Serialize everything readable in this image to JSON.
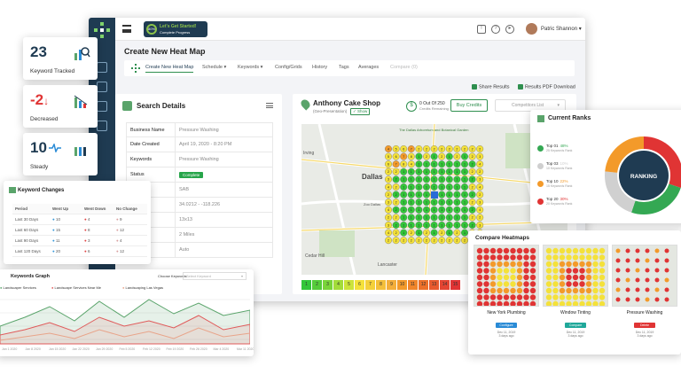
{
  "app": {
    "promo": {
      "progress": "80%",
      "title": "Let's Get Started!",
      "subtitle": "Complete Progress"
    },
    "user": {
      "name": "Patric Shannon"
    },
    "page_title": "Create New Heat Map",
    "tabs": [
      {
        "label": "Create New Heat Map",
        "active": true
      },
      {
        "label": "Schedule",
        "dropdown": true
      },
      {
        "label": "Keywords",
        "dropdown": true
      },
      {
        "label": "Config/Grids"
      },
      {
        "label": "History"
      },
      {
        "label": "Tags"
      },
      {
        "label": "Averages"
      },
      {
        "label": "Compare (0)",
        "disabled": true
      }
    ],
    "actions": {
      "share": "Share Results",
      "pdf": "Results PDF Download"
    }
  },
  "search_details": {
    "title": "Search Details",
    "rows": [
      {
        "key": "Business Name",
        "value": "Pressure Washing"
      },
      {
        "key": "Date Created",
        "value": "April 19, 2020 - 8:20 PM"
      },
      {
        "key": "Keywords",
        "value": "Pressure Washing"
      },
      {
        "key": "Status",
        "value": "Complete",
        "badge": true
      },
      {
        "key": "",
        "value": "SAB"
      },
      {
        "key": "",
        "value": "34.0212 - -118.226"
      },
      {
        "key": "",
        "value": "13x13"
      },
      {
        "key": "",
        "value": "2 Miles"
      },
      {
        "key": "",
        "value": "Auto"
      }
    ]
  },
  "map_card": {
    "business": "Anthony Cake Shop",
    "sub": "(Geo-Presentation)",
    "show_label": "Show",
    "credits_line1": "0 Out Of 250",
    "credits_line2": "Credits Remaining",
    "buy_label": "Buy Credits",
    "competitors_placeholder": "Competitors List",
    "city_labels": [
      "Dallas",
      "Irving",
      "Lancaster",
      "The Dallas Arboretum and Botanical Garden",
      "Zoo Dallas",
      "Cedar Hill"
    ],
    "scale": [
      "1",
      "2",
      "3",
      "4",
      "5",
      "6",
      "7",
      "8",
      "9",
      "10",
      "11",
      "12",
      "13",
      "14",
      "15"
    ],
    "colors": {
      "green": "#33c63a",
      "yellow": "#f4e13a",
      "orange": "#f39a2a",
      "red": "#e03434"
    }
  },
  "stats": [
    {
      "value": "23",
      "label": "Keyword Tracked",
      "icon": "magnifier-chart-icon"
    },
    {
      "value": "-2",
      "arrow": "↓",
      "label": "Decreased",
      "icon": "bar-chart-down-icon"
    },
    {
      "value": "10",
      "arrow": "⁄⁄",
      "label": "Steady",
      "icon": "steady-chart-icon"
    }
  ],
  "keyword_changes": {
    "title": "Keyword Changes",
    "headers": [
      "Period",
      "Went Up",
      "Went Down",
      "No Change"
    ],
    "rows": [
      {
        "period": "Last 30 Days",
        "up": "10",
        "down": "4",
        "none": "9"
      },
      {
        "period": "Last 60 Days",
        "up": "15",
        "down": "8",
        "none": "12"
      },
      {
        "period": "Last 90 Days",
        "up": "11",
        "down": "3",
        "none": "4"
      },
      {
        "period": "Last 120 Days",
        "up": "20",
        "down": "6",
        "none": "12"
      }
    ]
  },
  "keywords_graph": {
    "title": "Keywords Graph",
    "choose_label": "Choose Keywords",
    "choose_placeholder": "Select Keyword",
    "legend": [
      "Landscaper Services",
      "Landscape Services Near Me",
      "Landscaping Las Vegas"
    ],
    "x_labels": [
      "Jan 1 2020",
      "Jan 8 2020",
      "Jan 15 2020",
      "Jan 22 2020",
      "Jan 29 2020",
      "Feb 5 2020",
      "Feb 12 2020",
      "Feb 19 2020",
      "Feb 26 2020",
      "Mar 4 2020",
      "Mar 11 2020"
    ]
  },
  "current_ranks": {
    "title": "Current Ranks",
    "center_label": "RANKING",
    "items": [
      {
        "title": "Top 01",
        "pct": "48%",
        "sub": "25 Keywords Rank",
        "color": "#34a853"
      },
      {
        "title": "Top 03",
        "pct": "10%",
        "sub": "10 Keywords Rank",
        "color": "#cfcfcf"
      },
      {
        "title": "Top 10",
        "pct": "22%",
        "sub": "15 Keywords Rank",
        "color": "#f39a2a"
      },
      {
        "title": "Top 20",
        "pct": "30%",
        "sub": "20 Keywords Rank",
        "color": "#e03434"
      }
    ]
  },
  "compare_heatmaps": {
    "title": "Compare Heatmaps",
    "items": [
      {
        "name": "New York Plumbing",
        "tag": "Configure",
        "tag_color": "#2a8bd6",
        "date": "Dec 11, 2019",
        "sub": "3 days ago"
      },
      {
        "name": "Window Tinting",
        "tag": "Compare",
        "tag_color": "#20a89a",
        "date": "Dec 11, 2019",
        "sub": "3 days ago"
      },
      {
        "name": "Pressure Washing",
        "tag": "Delete",
        "tag_color": "#e03434",
        "date": "Dec 11, 2019",
        "sub": "3 days ago"
      }
    ]
  }
}
